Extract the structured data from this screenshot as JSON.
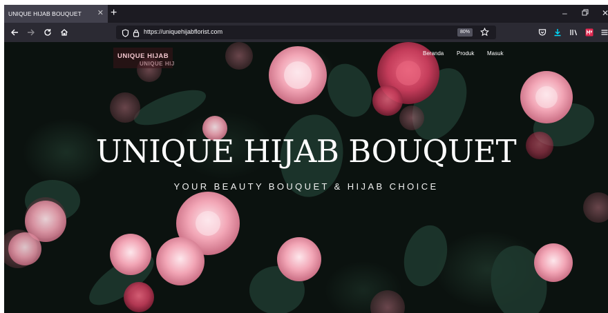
{
  "browser": {
    "tab_title": "UNIQUE HIJAB BOUQUET",
    "url": "https://uniquehijabflorist.com",
    "zoom": "80%",
    "icons": [
      "close-icon",
      "plus-icon",
      "minimize-icon",
      "restore-icon",
      "back-icon",
      "forward-icon",
      "reload-icon",
      "home-icon",
      "shield-icon",
      "lock-icon",
      "star-icon",
      "pocket-icon",
      "download-icon",
      "library-icon",
      "extension-icon",
      "menu-icon"
    ]
  },
  "site": {
    "logo_text": "UNIQUE HIJAB",
    "logo_echo": "UNIQUE HIJ",
    "nav": [
      "Beranda",
      "Produk",
      "Masuk"
    ],
    "hero_title": "UNIQUE HIJAB BOUQUET",
    "hero_subtitle": "YOUR BEAUTY BOUQUET & HIJAB CHOICE"
  },
  "colors": {
    "tab_bg": "#42414d",
    "toolbar_bg": "#2b2a33",
    "background": "#0b120f",
    "flower_pink": "#f2a6b6",
    "flower_rose": "#c43c5a",
    "download_accent": "#0df",
    "extension_red": "#e22850"
  }
}
